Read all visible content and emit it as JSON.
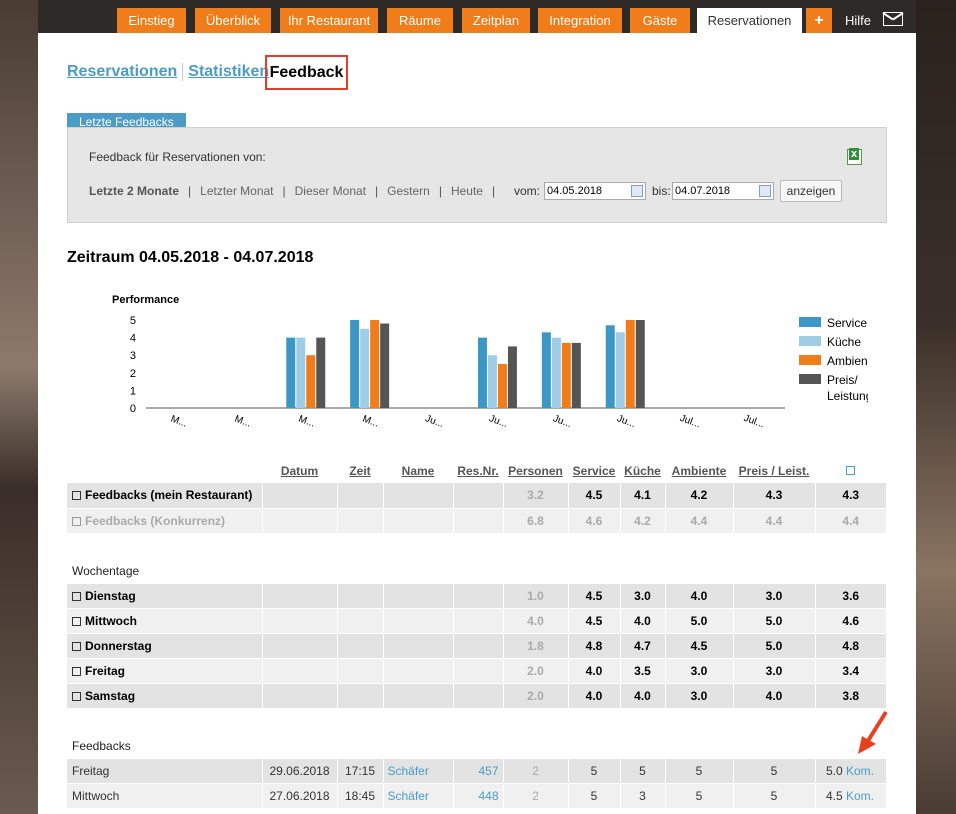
{
  "nav": {
    "tabs": [
      "Einstieg",
      "Überblick",
      "Ihr Restaurant",
      "Räume",
      "Zeitplan",
      "Integration",
      "Gäste",
      "Reservationen"
    ],
    "plus": "+",
    "help": "Hilfe"
  },
  "subnav": {
    "reservationen": "Reservationen",
    "statistiken": "Statistiken",
    "feedback": "Feedback"
  },
  "filter": {
    "section_title": "Letzte Feedbacks",
    "label": "Feedback für Reservationen von:",
    "ranges": [
      "Letzte 2 Monate",
      "Letzter Monat",
      "Dieser Monat",
      "Gestern",
      "Heute"
    ],
    "vom_label": "vom:",
    "vom_value": "04.05.2018",
    "bis_label": "bis:",
    "bis_value": "04.07.2018",
    "button": "anzeigen"
  },
  "zeitraum": "Zeitraum 04.05.2018 - 04.07.2018",
  "chart_data": {
    "type": "bar",
    "title": "Performance",
    "categories": [
      "M...",
      "M...",
      "M...",
      "M...",
      "Ju...",
      "Ju...",
      "Ju...",
      "Ju...",
      "Jul...",
      "Jul..."
    ],
    "ylim": [
      0,
      5
    ],
    "yticks": [
      0,
      1,
      2,
      3,
      4,
      5
    ],
    "series": [
      {
        "name": "Service",
        "color": "#3a97c6",
        "values": [
          null,
          null,
          4.0,
          5.0,
          null,
          4.0,
          4.3,
          4.7,
          null,
          null
        ]
      },
      {
        "name": "Küche",
        "color": "#9fcde6",
        "values": [
          null,
          null,
          4.0,
          4.5,
          null,
          3.0,
          4.0,
          4.3,
          null,
          null
        ]
      },
      {
        "name": "Ambiente",
        "color": "#f07d1a",
        "values": [
          null,
          null,
          3.0,
          5.0,
          null,
          2.5,
          3.7,
          5.0,
          null,
          null
        ]
      },
      {
        "name": "Preis/ Leistung",
        "color": "#555555",
        "values": [
          null,
          null,
          4.0,
          4.8,
          null,
          3.5,
          3.7,
          5.0,
          null,
          null
        ]
      }
    ],
    "legend_position": "right"
  },
  "table": {
    "headers": [
      "Datum",
      "Zeit",
      "Name",
      "Res.Nr.",
      "Personen",
      "Service",
      "Küche",
      "Ambiente",
      "Preis / Leist."
    ],
    "summary": [
      {
        "label": "Feedbacks (mein Restaurant)",
        "personen": "3.2",
        "service": "4.5",
        "kueche": "4.1",
        "ambiente": "4.2",
        "preis": "4.3",
        "avg": "4.3"
      },
      {
        "label": "Feedbacks (Konkurrenz)",
        "personen": "6.8",
        "service": "4.6",
        "kueche": "4.2",
        "ambiente": "4.4",
        "preis": "4.4",
        "avg": "4.4"
      }
    ],
    "weekdays_title": "Wochentage",
    "weekdays": [
      {
        "label": "Dienstag",
        "personen": "1.0",
        "service": "4.5",
        "kueche": "3.0",
        "ambiente": "4.0",
        "preis": "3.0",
        "avg": "3.6"
      },
      {
        "label": "Mittwoch",
        "personen": "4.0",
        "service": "4.5",
        "kueche": "4.0",
        "ambiente": "5.0",
        "preis": "5.0",
        "avg": "4.6"
      },
      {
        "label": "Donnerstag",
        "personen": "1.8",
        "service": "4.8",
        "kueche": "4.7",
        "ambiente": "4.5",
        "preis": "5.0",
        "avg": "4.8"
      },
      {
        "label": "Freitag",
        "personen": "2.0",
        "service": "4.0",
        "kueche": "3.5",
        "ambiente": "3.0",
        "preis": "3.0",
        "avg": "3.4"
      },
      {
        "label": "Samstag",
        "personen": "2.0",
        "service": "4.0",
        "kueche": "4.0",
        "ambiente": "3.0",
        "preis": "4.0",
        "avg": "3.8"
      }
    ],
    "feedbacks_title": "Feedbacks",
    "feedbacks": [
      {
        "day": "Freitag",
        "date": "29.06.2018",
        "time": "17:15",
        "name": "Schäfer",
        "resnr": "457",
        "personen": "2",
        "service": "5",
        "kueche": "5",
        "ambiente": "5",
        "preis": "5",
        "avg": "5.0",
        "kom": "Kom."
      },
      {
        "day": "Mittwoch",
        "date": "27.06.2018",
        "time": "18:45",
        "name": "Schäfer",
        "resnr": "448",
        "personen": "2",
        "service": "5",
        "kueche": "3",
        "ambiente": "5",
        "preis": "5",
        "avg": "4.5",
        "kom": "Kom."
      }
    ]
  }
}
